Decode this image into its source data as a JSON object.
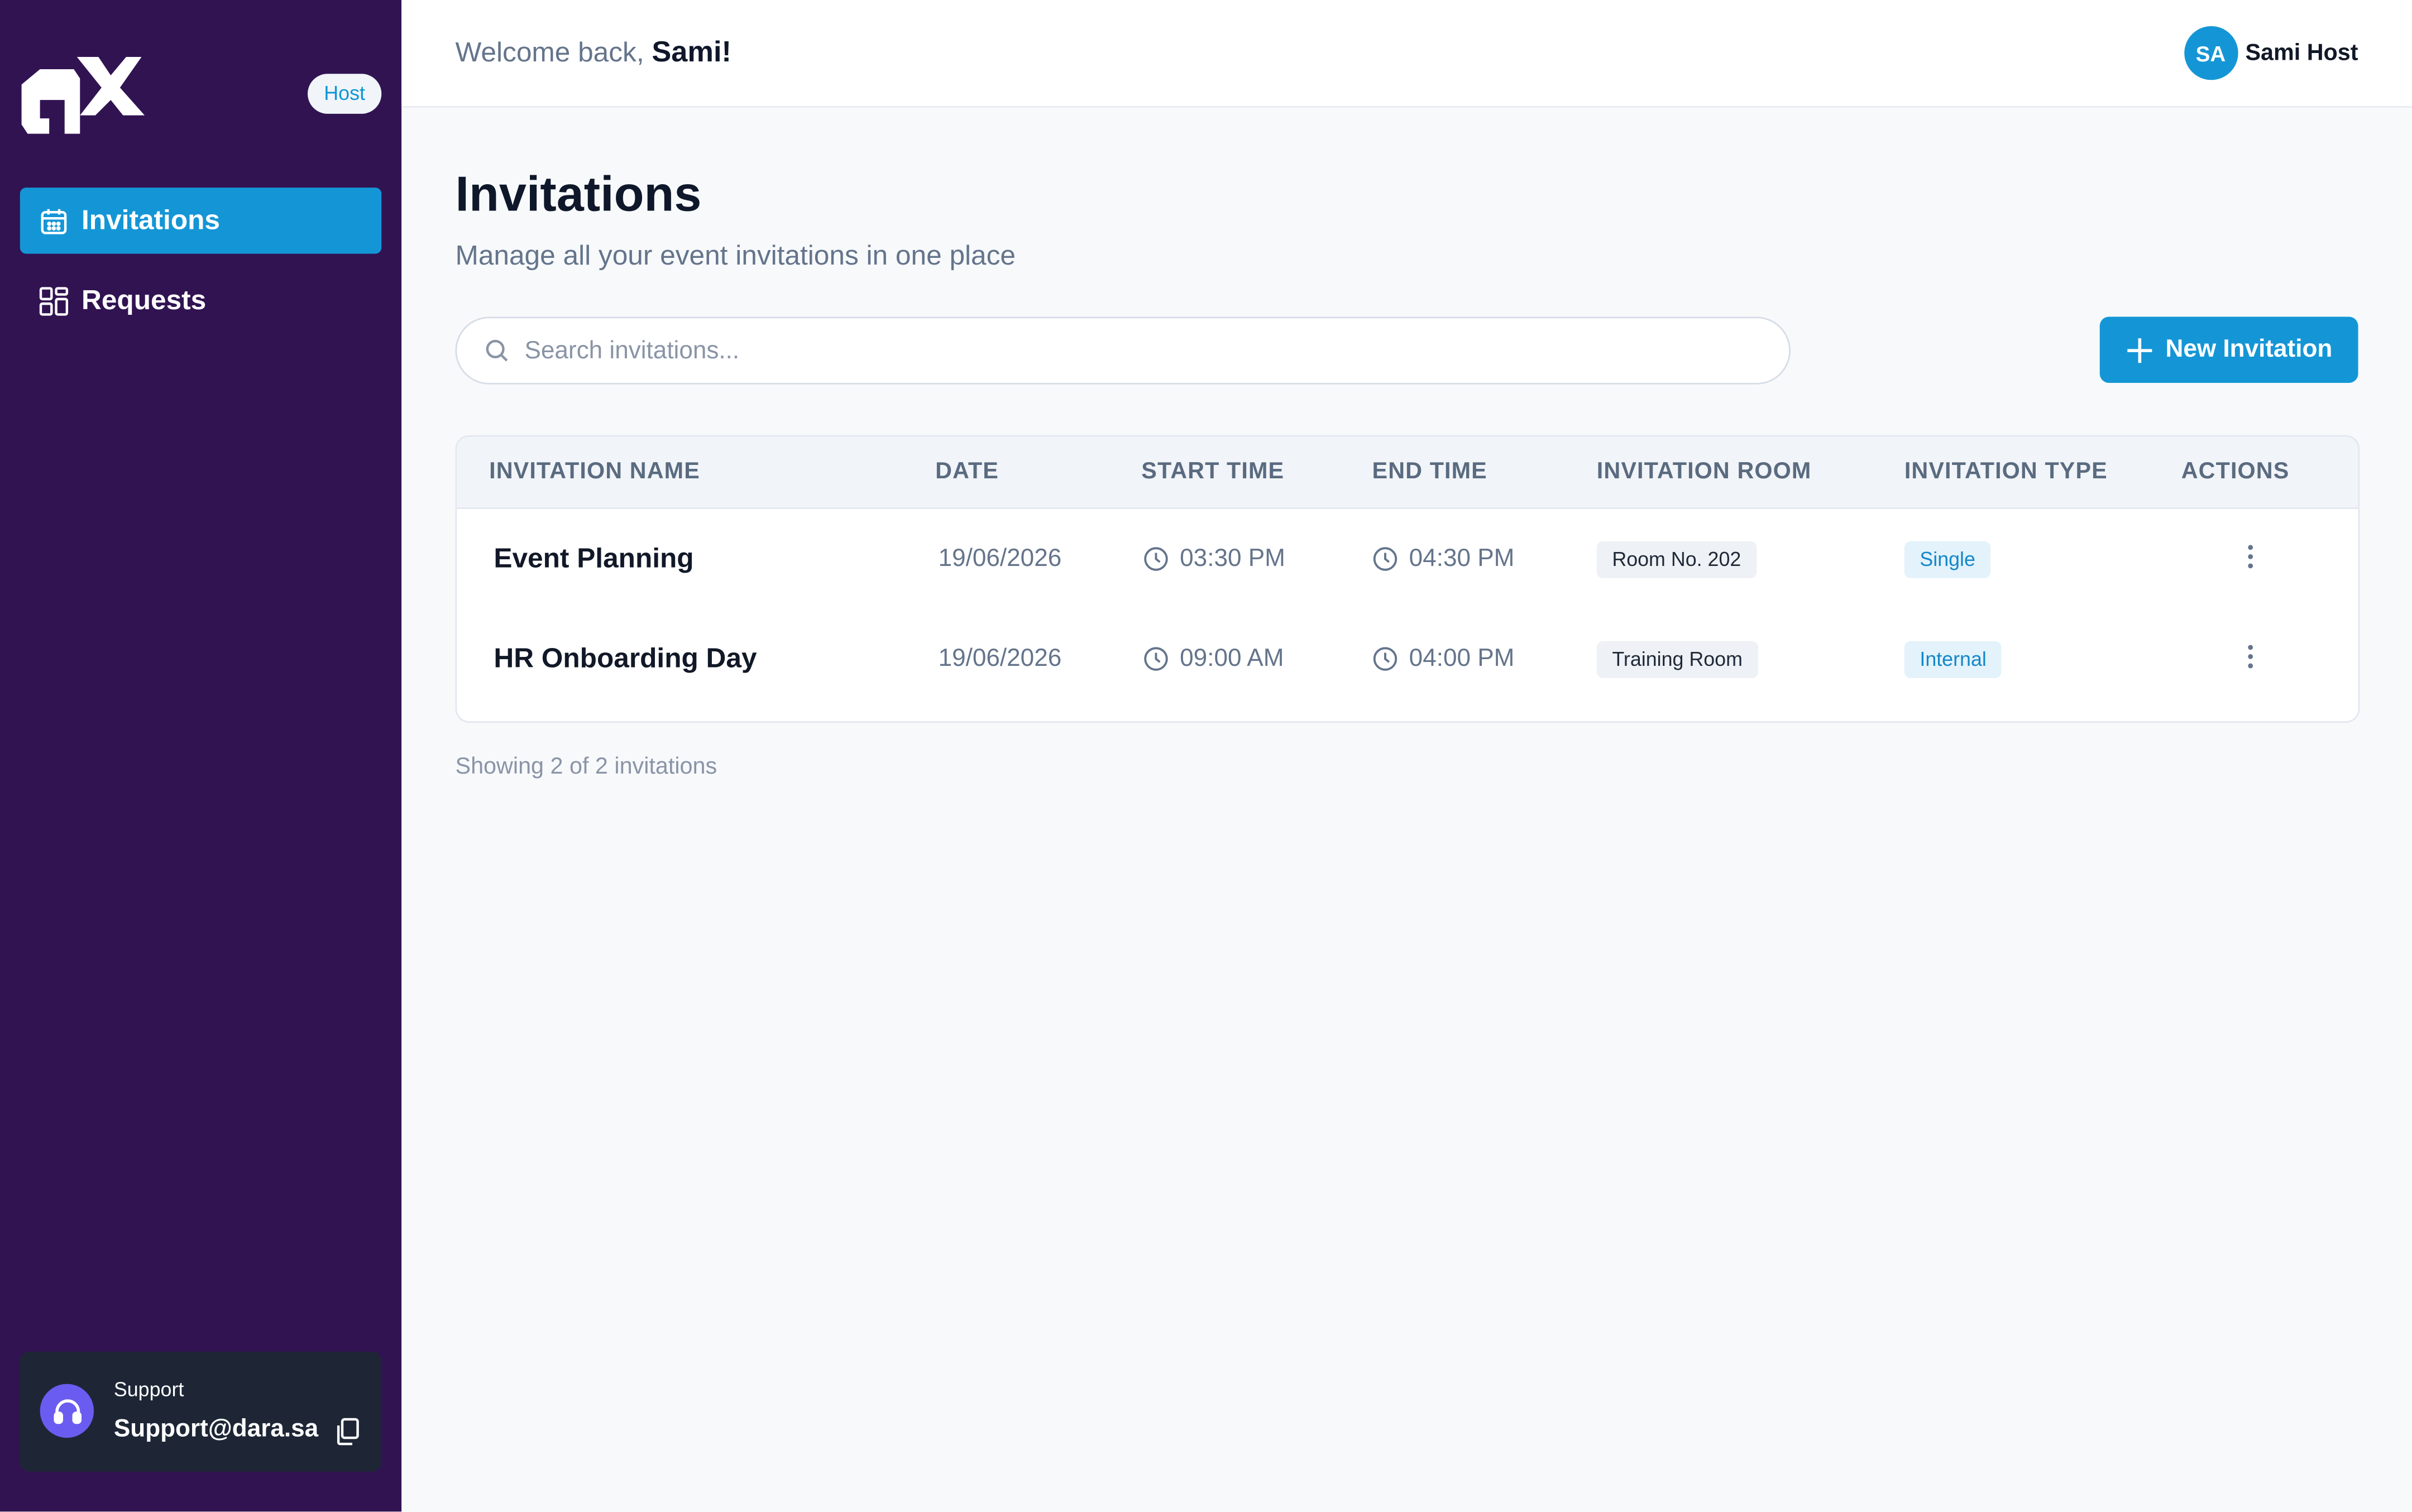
{
  "app": {
    "role_badge": "Host",
    "nav": [
      {
        "label": "Invitations",
        "icon": "calendar-icon",
        "active": true
      },
      {
        "label": "Requests",
        "icon": "grid-icon",
        "active": false
      }
    ],
    "support": {
      "label": "Support",
      "email": "Support@dara.sa"
    }
  },
  "header": {
    "welcome_prefix": "Welcome back, ",
    "welcome_name": "Sami!",
    "user_initials": "SA",
    "user_name": "Sami Host"
  },
  "page": {
    "title": "Invitations",
    "subtitle": "Manage all your event invitations in one place",
    "search_placeholder": "Search invitations...",
    "new_button": "New Invitation"
  },
  "table": {
    "columns": [
      "INVITATION NAME",
      "DATE",
      "START TIME",
      "END TIME",
      "INVITATION ROOM",
      "INVITATION TYPE",
      "ACTIONS"
    ],
    "rows": [
      {
        "name": "Event Planning",
        "date": "19/06/2026",
        "start": "03:30 PM",
        "end": "04:30 PM",
        "room": "Room No. 202",
        "type": "Single"
      },
      {
        "name": "HR Onboarding Day",
        "date": "19/06/2026",
        "start": "09:00 AM",
        "end": "04:00 PM",
        "room": "Training Room",
        "type": "Internal"
      }
    ]
  },
  "footer": {
    "count_text": "Showing 2 of 2 invitations"
  },
  "colors": {
    "sidebar": "#311352",
    "accent": "#1496d6",
    "support_icon": "#6a5cf0"
  }
}
